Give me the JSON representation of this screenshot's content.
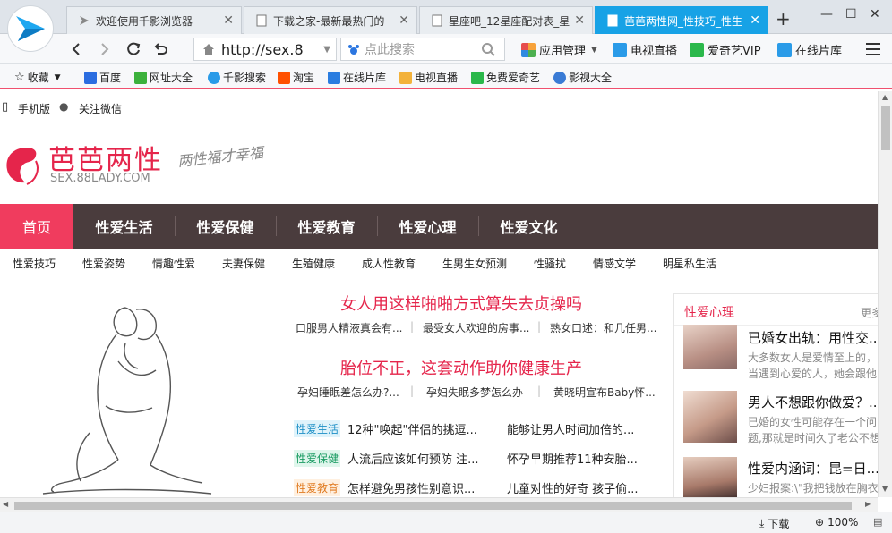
{
  "tabs": [
    {
      "title": "欢迎使用千影浏览器",
      "active": false
    },
    {
      "title": "下载之家-最新最热门的",
      "active": false
    },
    {
      "title": "星座吧_12星座配对表_星",
      "active": false
    },
    {
      "title": "芭芭两性网_性技巧_性生",
      "active": true
    }
  ],
  "address": {
    "url": "http://sex.8",
    "search_placeholder": "点此搜索"
  },
  "toolbar": {
    "app_manage": "应用管理",
    "tv_live": "电视直播",
    "iqiyi_vip": "爱奇艺VIP",
    "online_cinema": "在线片库"
  },
  "bookmarks": {
    "favorites": "收藏",
    "items": [
      "百度",
      "网址大全",
      "千影搜索",
      "淘宝",
      "在线片库",
      "电视直播",
      "免费爱奇艺",
      "影视大全"
    ]
  },
  "site": {
    "mobile": "手机版",
    "wechat": "关注微信",
    "logo_cn": "芭芭两性",
    "logo_domain": "SEX.88LADY.COM",
    "slogan": "两性福才幸福",
    "nav": [
      "首页",
      "性爱生活",
      "性爱保健",
      "性爱教育",
      "性爱心理",
      "性爱文化"
    ],
    "subnav": [
      "性爱技巧",
      "性爱姿势",
      "情趣性爱",
      "夫妻保健",
      "生殖健康",
      "成人性教育",
      "生男生女预测",
      "性骚扰",
      "情感文学",
      "明星私生活"
    ],
    "headline1": "女人用这样啪啪方式算失去贞操吗",
    "sub1": [
      "口服男人精液真会有...",
      "最受女人欢迎的房事...",
      "熟女口述：和几任男..."
    ],
    "headline2": "胎位不正，这套动作助你健康生产",
    "sub2": [
      "孕妇睡眠差怎么办?...",
      "孕妇失眠多梦怎么办",
      "黄晓明宣布Baby怀..."
    ],
    "articles": [
      {
        "tag": "性爱生活",
        "left": "12种\"唤起\"伴侣的挑逗...",
        "right": "能够让男人时间加倍的..."
      },
      {
        "tag": "性爱保健",
        "left": "人流后应该如何预防 注...",
        "right": "怀孕早期推荐11种安胎..."
      },
      {
        "tag": "性爱教育",
        "left": "怎样避免男孩性别意识...",
        "right": "儿童对性的好奇 孩子偷..."
      }
    ],
    "sidebar": {
      "title": "性爱心理",
      "more": "更多",
      "items": [
        {
          "title": "已婚女出轨：用性交...",
          "desc1": "大多数女人是爱情至上的，",
          "desc2": "当遇到心爱的人，她会跟他"
        },
        {
          "title": "男人不想跟你做爱？...",
          "desc1": "已婚的女性可能存在一个问",
          "desc2": "题,那就是时间久了老公不想"
        },
        {
          "title": "性爱内涵词：昆=日...",
          "desc1": "少妇报案:\\\"我把钱放在胸衣"
        }
      ]
    }
  },
  "status": {
    "download": "下载",
    "zoom": "100%"
  },
  "colors": {
    "accent": "#f03c5e",
    "tab_active": "#17a2e6",
    "nav_bg": "#4a3c3d",
    "headline": "#e5254b"
  }
}
